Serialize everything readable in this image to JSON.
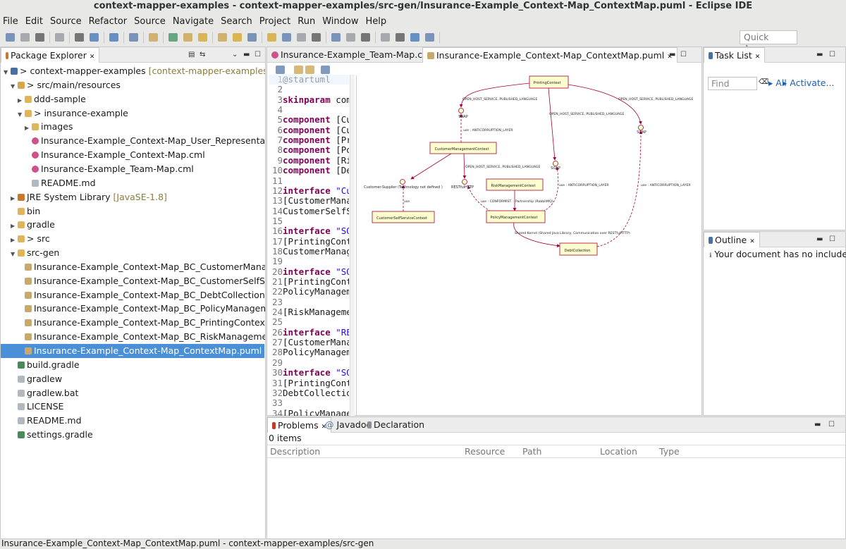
{
  "window": {
    "title": "context-mapper-examples - context-mapper-examples/src-gen/Insurance-Example_Context-Map_ContextMap.puml - Eclipse IDE"
  },
  "menu": [
    "File",
    "Edit",
    "Source",
    "Refactor",
    "Source",
    "Navigate",
    "Search",
    "Project",
    "Run",
    "Window",
    "Help"
  ],
  "quick_access": {
    "placeholder": "Quick Access"
  },
  "package_explorer": {
    "title": "Package Explorer",
    "rows": [
      {
        "label": "> context-mapper-examples",
        "decoration": "[context-mapper-examples master]",
        "indent": 0,
        "twisty": "open",
        "icon": "project-icon"
      },
      {
        "label": "> src/main/resources",
        "indent": 1,
        "twisty": "open",
        "icon": "source-folder-icon"
      },
      {
        "label": "ddd-sample",
        "indent": 2,
        "twisty": "closed",
        "icon": "folder-icon"
      },
      {
        "label": "> insurance-example",
        "indent": 2,
        "twisty": "open",
        "icon": "folder-icon"
      },
      {
        "label": "images",
        "indent": 3,
        "twisty": "closed",
        "icon": "folder-icon"
      },
      {
        "label": "Insurance-Example_Context-Map_User_Representations.cml",
        "indent": 3,
        "icon": "cml-file-icon"
      },
      {
        "label": "Insurance-Example_Context-Map.cml",
        "indent": 3,
        "icon": "cml-file-icon"
      },
      {
        "label": "Insurance-Example_Team-Map.cml",
        "indent": 3,
        "icon": "cml-file-icon"
      },
      {
        "label": "README.md",
        "indent": 3,
        "icon": "file-icon"
      },
      {
        "label": "JRE System Library",
        "decoration": "[JavaSE-1.8]",
        "indent": 1,
        "twisty": "closed",
        "icon": "library-icon"
      },
      {
        "label": "bin",
        "indent": 1,
        "icon": "folder-icon"
      },
      {
        "label": "gradle",
        "indent": 1,
        "twisty": "closed",
        "icon": "folder-icon"
      },
      {
        "label": "> src",
        "indent": 1,
        "twisty": "closed",
        "icon": "folder-icon"
      },
      {
        "label": "src-gen",
        "indent": 1,
        "twisty": "open",
        "icon": "folder-icon"
      },
      {
        "label": "Insurance-Example_Context-Map_BC_CustomerManagementContext.puml",
        "indent": 2,
        "icon": "puml-file-icon"
      },
      {
        "label": "Insurance-Example_Context-Map_BC_CustomerSelfServiceContext.puml",
        "indent": 2,
        "icon": "puml-file-icon"
      },
      {
        "label": "Insurance-Example_Context-Map_BC_DebtCollection.puml",
        "indent": 2,
        "icon": "puml-file-icon"
      },
      {
        "label": "Insurance-Example_Context-Map_BC_PolicyManagementContext.puml",
        "indent": 2,
        "icon": "puml-file-icon"
      },
      {
        "label": "Insurance-Example_Context-Map_BC_PrintingContext.puml",
        "indent": 2,
        "icon": "puml-file-icon"
      },
      {
        "label": "Insurance-Example_Context-Map_BC_RiskManagementContext.puml",
        "indent": 2,
        "icon": "puml-file-icon"
      },
      {
        "label": "Insurance-Example_Context-Map_ContextMap.puml",
        "indent": 2,
        "icon": "puml-file-icon",
        "selected": true
      },
      {
        "label": "build.gradle",
        "indent": 1,
        "icon": "gradle-file-icon"
      },
      {
        "label": "gradlew",
        "indent": 1,
        "icon": "file-icon"
      },
      {
        "label": "gradlew.bat",
        "indent": 1,
        "icon": "file-icon"
      },
      {
        "label": "LICENSE",
        "indent": 1,
        "icon": "file-icon"
      },
      {
        "label": "README.md",
        "indent": 1,
        "icon": "file-icon"
      },
      {
        "label": "settings.gradle",
        "indent": 1,
        "icon": "gradle-file-icon"
      }
    ]
  },
  "editor": {
    "tabs": [
      {
        "label": "Insurance-Example_Team-Map.cml"
      },
      {
        "label": "Insurance-Example_Context-Map_ContextMap.puml",
        "active": true
      }
    ],
    "lines": [
      [
        [
          "n",
          "@startuml"
        ]
      ],
      [],
      [
        [
          "k",
          "skinparam"
        ],
        [
          "n",
          " com"
        ]
      ],
      [],
      [
        [
          "k",
          "component"
        ],
        [
          "n",
          " [Cu"
        ]
      ],
      [
        [
          "k",
          "component"
        ],
        [
          "n",
          " [Cu"
        ]
      ],
      [
        [
          "k",
          "component"
        ],
        [
          "n",
          " [Pr"
        ]
      ],
      [
        [
          "k",
          "component"
        ],
        [
          "n",
          " [Po"
        ]
      ],
      [
        [
          "k",
          "component"
        ],
        [
          "n",
          " [Ri"
        ]
      ],
      [
        [
          "k",
          "component"
        ],
        [
          "n",
          " [De"
        ]
      ],
      [],
      [
        [
          "k",
          "interface"
        ],
        [
          "s",
          " \"Cu"
        ]
      ],
      [
        [
          "n",
          "[CustomerMana"
        ]
      ],
      [
        [
          "n",
          "CustomerSelfSe"
        ]
      ],
      [],
      [
        [
          "k",
          "interface"
        ],
        [
          "s",
          " \"SO"
        ]
      ],
      [
        [
          "n",
          "[PrintingCont"
        ]
      ],
      [
        [
          "n",
          "CustomerManage"
        ]
      ],
      [],
      [
        [
          "k",
          "interface"
        ],
        [
          "s",
          " \"SO"
        ]
      ],
      [
        [
          "n",
          "[PrintingCont"
        ]
      ],
      [
        [
          "n",
          "PolicyManageme"
        ]
      ],
      [],
      [
        [
          "n",
          "[RiskManageme"
        ]
      ],
      [],
      [
        [
          "k",
          "interface"
        ],
        [
          "s",
          " \"RE"
        ]
      ],
      [
        [
          "n",
          "[CustomerMana"
        ]
      ],
      [
        [
          "n",
          "PolicyManageme"
        ]
      ],
      [],
      [
        [
          "k",
          "interface"
        ],
        [
          "s",
          " \"SO"
        ]
      ],
      [
        [
          "n",
          "[PrintingCont"
        ]
      ],
      [
        [
          "n",
          "DebtCollectio"
        ]
      ],
      [],
      [
        [
          "n",
          "[PolicyManage"
        ]
      ]
    ]
  },
  "diagram": {
    "components": [
      "PrintingContext",
      "CustomerManagementContext",
      "CustomerSelfServiceContext",
      "RiskManagementContext",
      "PolicyManagementContext",
      "DebtCollection"
    ],
    "interfaces": [
      "SOAP",
      "SOAP",
      "SOAP",
      "Customer-Supplier (Technology not defined )",
      "RESTfulHTTP"
    ],
    "labels": [
      "OPEN_HOST_SERVICE, PUBLISHED_LANGUAGE",
      "OPEN_HOST_SERVICE, PUBLISHED_LANGUAGE",
      "OPEN_HOST_SERVICE, PUBLISHED_LANGUAGE",
      "use : ANTICORRUPTION_LAYER",
      "OPEN_HOST_SERVICE, PUBLISHED_LANGUAGE",
      "use : ANTICORRUPTION_LAYER",
      "use : ANTICORRUPTION_LAYER",
      "use",
      "use : CONFORMIST",
      "Partnership (RabbitMQ)",
      "Shared Kernel (Shared Java Library, Communication over RESTfulHTTP)"
    ],
    "colors": {
      "box": "#fefece",
      "border": "#a80036"
    }
  },
  "task_list": {
    "title": "Task List",
    "find_placeholder": "Find",
    "all": "All",
    "activate": "Activate..."
  },
  "outline": {
    "title": "Outline",
    "message": "Your document has no includes or"
  },
  "problems": {
    "tabs": [
      "Problems",
      "Javadoc",
      "Declaration"
    ],
    "count": "0 items",
    "columns": [
      "Description",
      "Resource",
      "Path",
      "Location",
      "Type"
    ]
  },
  "status": {
    "text": "Insurance-Example_Context-Map_ContextMap.puml - context-mapper-examples/src-gen"
  }
}
